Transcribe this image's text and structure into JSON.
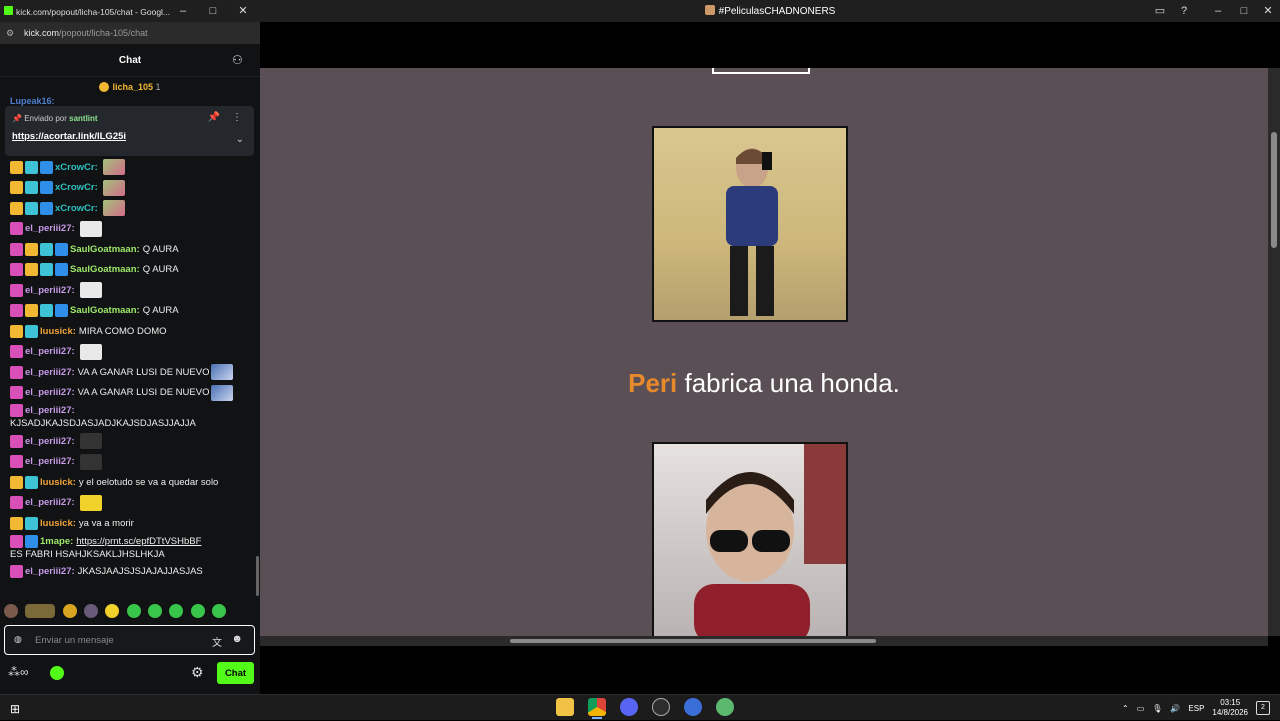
{
  "chat_window": {
    "title": "kick.com/popout/licha-105/chat - Googl...",
    "url_host": "kick.com",
    "url_path": "/popout/licha-105/chat",
    "header": "Chat",
    "host": {
      "name": "licha_105",
      "count": "1"
    },
    "partial_user": "Lupeak16:",
    "pinned": {
      "prefix": "Enviado por",
      "user": "santlint",
      "link": "https://acortar.link/lLG25i"
    },
    "messages": [
      {
        "badges": [
          "crown",
          "sub",
          "sparkle"
        ],
        "user": "xCrowCr:",
        "color": "#2ec0c0",
        "text": "",
        "emote": "em-pic"
      },
      {
        "badges": [
          "crown",
          "sub",
          "sparkle"
        ],
        "user": "xCrowCr:",
        "color": "#2ec0c0",
        "text": "",
        "emote": "em-pic"
      },
      {
        "badges": [
          "crown",
          "sub",
          "sparkle"
        ],
        "user": "xCrowCr:",
        "color": "#2ec0c0",
        "text": "",
        "emote": "em-pic"
      },
      {
        "badges": [
          "og"
        ],
        "user": "el_periii27:",
        "color": "#c79be8",
        "text": "",
        "emote": "em-white"
      },
      {
        "badges": [
          "og",
          "crown",
          "sub",
          "sparkle"
        ],
        "user": "SaulGoatmaan:",
        "color": "#9ee86a",
        "text": "Q AURA",
        "emote": ""
      },
      {
        "badges": [
          "og",
          "crown",
          "sub",
          "sparkle"
        ],
        "user": "SaulGoatmaan:",
        "color": "#9ee86a",
        "text": "Q AURA",
        "emote": ""
      },
      {
        "badges": [
          "og"
        ],
        "user": "el_periii27:",
        "color": "#c79be8",
        "text": "",
        "emote": "em-white"
      },
      {
        "badges": [
          "og",
          "crown",
          "sub",
          "sparkle"
        ],
        "user": "SaulGoatmaan:",
        "color": "#9ee86a",
        "text": "Q AURA",
        "emote": ""
      },
      {
        "badges": [
          "crown",
          "sub"
        ],
        "user": "luusick:",
        "color": "#f2a23a",
        "text": "MIRA COMO DOMO",
        "emote": ""
      },
      {
        "badges": [
          "og"
        ],
        "user": "el_periii27:",
        "color": "#c79be8",
        "text": "",
        "emote": "em-white"
      },
      {
        "badges": [
          "og"
        ],
        "user": "el_periii27:",
        "color": "#c79be8",
        "text": "VA A GANAR LUSI DE NUEVO",
        "emote": "em-blue"
      },
      {
        "badges": [
          "og"
        ],
        "user": "el_periii27:",
        "color": "#c79be8",
        "text": "VA A GANAR LUSI DE NUEVO",
        "emote": "em-blue"
      },
      {
        "badges": [
          "og"
        ],
        "user": "el_periii27:",
        "color": "#c79be8",
        "text": "KJSADJKAJSDJASJADJKAJSDJASJJAJJA",
        "emote": ""
      },
      {
        "badges": [
          "og"
        ],
        "user": "el_periii27:",
        "color": "#c79be8",
        "text": "",
        "emote": "em-dark"
      },
      {
        "badges": [
          "og"
        ],
        "user": "el_periii27:",
        "color": "#c79be8",
        "text": "",
        "emote": "em-dark"
      },
      {
        "badges": [
          "crown",
          "sub"
        ],
        "user": "luusick:",
        "color": "#f2a23a",
        "text": "y el oelotudo se va a quedar solo",
        "emote": ""
      },
      {
        "badges": [
          "og"
        ],
        "user": "el_periii27:",
        "color": "#c79be8",
        "text": "",
        "emote": "em-yellow"
      },
      {
        "badges": [
          "crown",
          "sub"
        ],
        "user": "luusick:",
        "color": "#f2a23a",
        "text": "ya va a morir",
        "emote": ""
      },
      {
        "badges": [
          "og",
          "sparkle"
        ],
        "user": "1mape:",
        "color": "#9ee86a",
        "link": "https://prnt.sc/epfDTtVSHbBF",
        "text": "ES FABRI HSAHJKSAKLJHSLHKJA",
        "emote": ""
      },
      {
        "badges": [
          "og"
        ],
        "user": "el_periii27:",
        "color": "#c79be8",
        "text": "JKASJAAJSJSJAJAJJASJAS",
        "emote": ""
      }
    ],
    "input_placeholder": "Enviar un mensaje",
    "chat_button": "Chat"
  },
  "stream_window": {
    "title": "#PeliculasCHADNONERS",
    "caption_highlight": "Peri",
    "caption_rest": " fabrica una honda."
  },
  "taskbar": {
    "lang": "ESP",
    "time": "03:15",
    "date": "14/8/2026",
    "notifications": "2"
  },
  "colors": {
    "kick_green": "#53fc18",
    "stage_bg": "#5a4f54",
    "caption_accent": "#e8892b"
  }
}
